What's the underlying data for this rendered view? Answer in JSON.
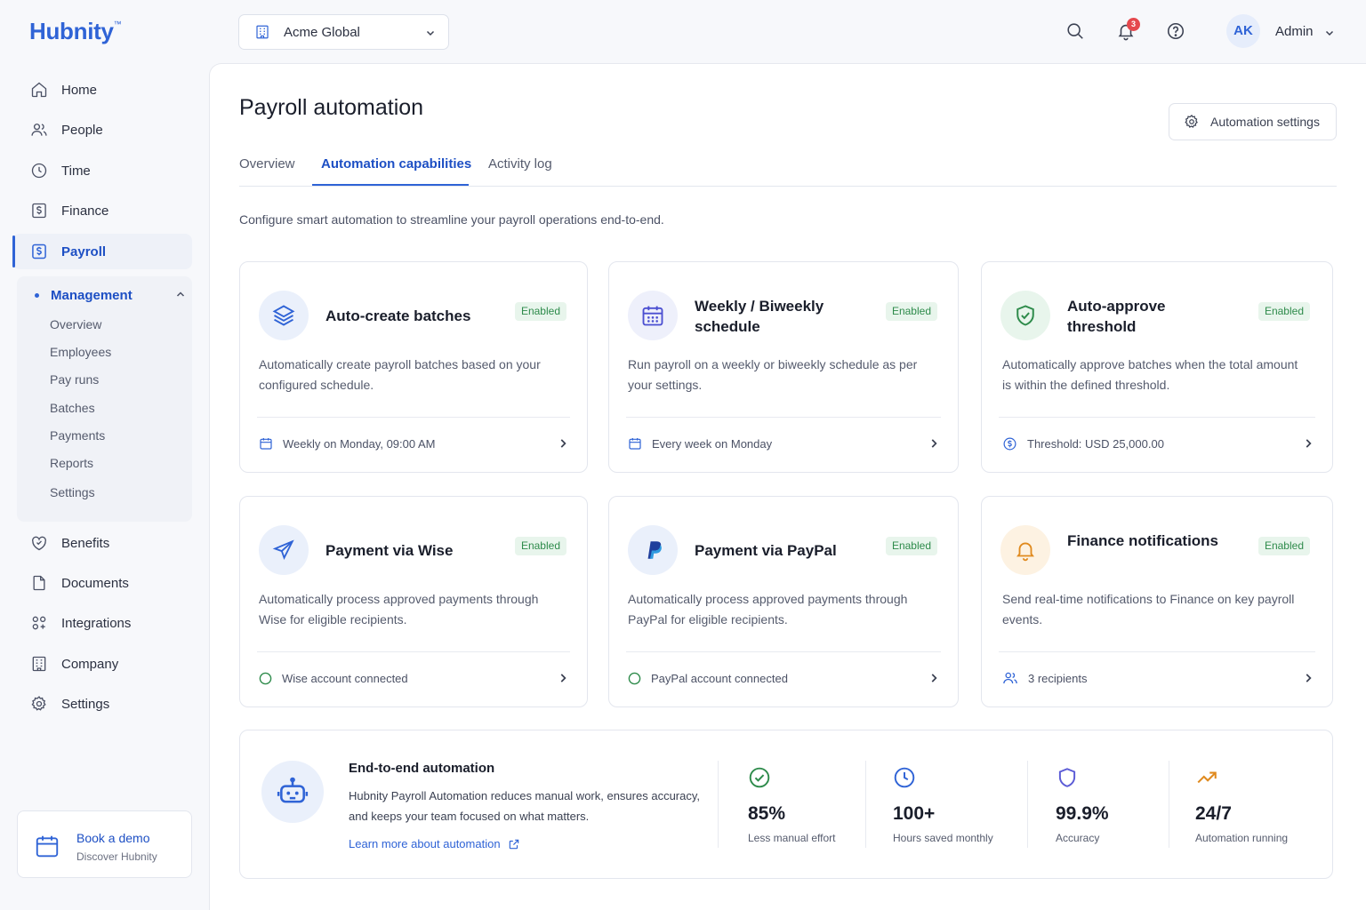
{
  "brand": {
    "name": "Hubnity",
    "tm": "™"
  },
  "topbar": {
    "org": "Acme Global",
    "notifications_count": "3",
    "avatar_initials": "AK",
    "user_name": "Admin"
  },
  "sidebar": {
    "items": [
      {
        "label": "Home",
        "icon": "home-icon"
      },
      {
        "label": "People",
        "icon": "people-icon"
      },
      {
        "label": "Time",
        "icon": "clock-icon"
      },
      {
        "label": "Finance",
        "icon": "finance-icon"
      },
      {
        "label": "Payroll",
        "icon": "payroll-icon"
      },
      {
        "label": "Benefits",
        "icon": "heart-shield-icon"
      },
      {
        "label": "Documents",
        "icon": "document-icon"
      },
      {
        "label": "Integrations",
        "icon": "puzzle-icon"
      },
      {
        "label": "Company",
        "icon": "building-icon"
      },
      {
        "label": "Settings",
        "icon": "gear-icon"
      }
    ],
    "submenu": {
      "title": "Management",
      "items": [
        "Overview",
        "Employees",
        "Pay runs",
        "Batches",
        "Payments",
        "Reports",
        "Settings"
      ]
    },
    "demo": {
      "title": "Book a demo",
      "subtitle": "Discover Hubnity"
    }
  },
  "page": {
    "title": "Payroll automation",
    "settings_button": "Automation settings",
    "tabs": [
      "Overview",
      "Automation capabilities",
      "Activity log"
    ],
    "active_tab": "Automation capabilities",
    "intro": "Configure smart automation to streamline your payroll operations end-to-end."
  },
  "cards": [
    {
      "title": "Auto-create batches",
      "status": "Enabled",
      "description": "Automatically create payroll batches based on your configured schedule.",
      "footer": "Weekly on Monday, 09:00 AM",
      "icon": "layers-icon",
      "footer_icon": "calendar-icon"
    },
    {
      "title": "Weekly / Biweekly schedule",
      "status": "Enabled",
      "description": "Run payroll on a weekly or biweekly schedule as per your settings.",
      "footer": "Every week on Monday",
      "icon": "calendar-icon",
      "footer_icon": "calendar-icon"
    },
    {
      "title": "Auto-approve threshold",
      "status": "Enabled",
      "description": "Automatically approve batches when the total amount is within the defined threshold.",
      "footer": "Threshold: USD 25,000.00",
      "icon": "shield-check-icon",
      "footer_icon": "dollar-circle-icon"
    },
    {
      "title": "Payment via Wise",
      "status": "Enabled",
      "description": "Automatically process approved payments through Wise for eligible recipients.",
      "footer": "Wise account connected",
      "icon": "send-icon",
      "footer_icon": "circle-icon"
    },
    {
      "title": "Payment via PayPal",
      "status": "Enabled",
      "description": "Automatically process approved payments through PayPal for eligible recipients.",
      "footer": "PayPal account connected",
      "icon": "paypal-icon",
      "footer_icon": "circle-icon"
    },
    {
      "title": "Finance notifications",
      "status": "Enabled",
      "description": "Send real-time notifications to Finance on key payroll events.",
      "footer": "3 recipients",
      "icon": "bell-icon",
      "footer_icon": "users-icon"
    }
  ],
  "summary": {
    "title": "End-to-end automation",
    "description": "Hubnity Payroll Automation reduces manual work, ensures accuracy, and keeps your team focused on what matters.",
    "link": "Learn more about automation",
    "stats": [
      {
        "value": "85%",
        "label": "Less manual effort",
        "icon": "check-circle-icon",
        "color": "#2e8b4b"
      },
      {
        "value": "100+",
        "label": "Hours saved monthly",
        "icon": "clock-icon",
        "color": "#2f63d6"
      },
      {
        "value": "99.9%",
        "label": "Accuracy",
        "icon": "shield-icon",
        "color": "#5b5bd6"
      },
      {
        "value": "24/7",
        "label": "Automation running",
        "icon": "trend-up-icon",
        "color": "#e08a1e"
      }
    ]
  },
  "colors": {
    "accent": "#2f63d6",
    "enabled_bg": "#e8f5ec",
    "enabled_text": "#2e8b4b",
    "badge": "#e5484d"
  }
}
